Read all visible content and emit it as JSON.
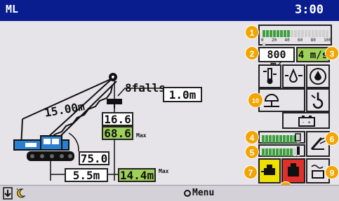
{
  "titlebar": {
    "title": "ML",
    "clock": "3:00"
  },
  "crane": {
    "falls": "8falls",
    "line_length": "1.0m",
    "boom_length": "15.00m",
    "actual_load": "16.6",
    "rated_load": "68.6",
    "rated_suffix": "Max",
    "boom_angle": "75.0",
    "working_radius": "5.5m",
    "max_radius": "14.4m",
    "max_radius_suffix": "Max"
  },
  "panel": {
    "load_bar_scale": [
      "0",
      "20",
      "40",
      "60",
      "80",
      "100"
    ],
    "load_bar_percent": 40,
    "wind_area": "800 m²",
    "wind_speed": "4 m/s",
    "fuel_segments_on": 10,
    "temp_segments_on": 9,
    "indicator_colors": {
      "yellow": "#f0e000",
      "red": "#e0302a",
      "green": "#9fd05a"
    }
  },
  "badges": [
    "1",
    "2",
    "3",
    "4",
    "5",
    "6",
    "7",
    "8",
    "9",
    "10"
  ],
  "icons": [
    "hydraulic-temp-icon",
    "oil-level-icon",
    "oil-drop-icon",
    "lamp-icon",
    "hook-icon",
    "battery-icon",
    "wiper-icon",
    "fuel-icon",
    "engine-oil-icon",
    "emergency-stop-icon",
    "sun-icon",
    "arrow-down-icon"
  ],
  "bottombar": {
    "menu_label": "Menu"
  }
}
